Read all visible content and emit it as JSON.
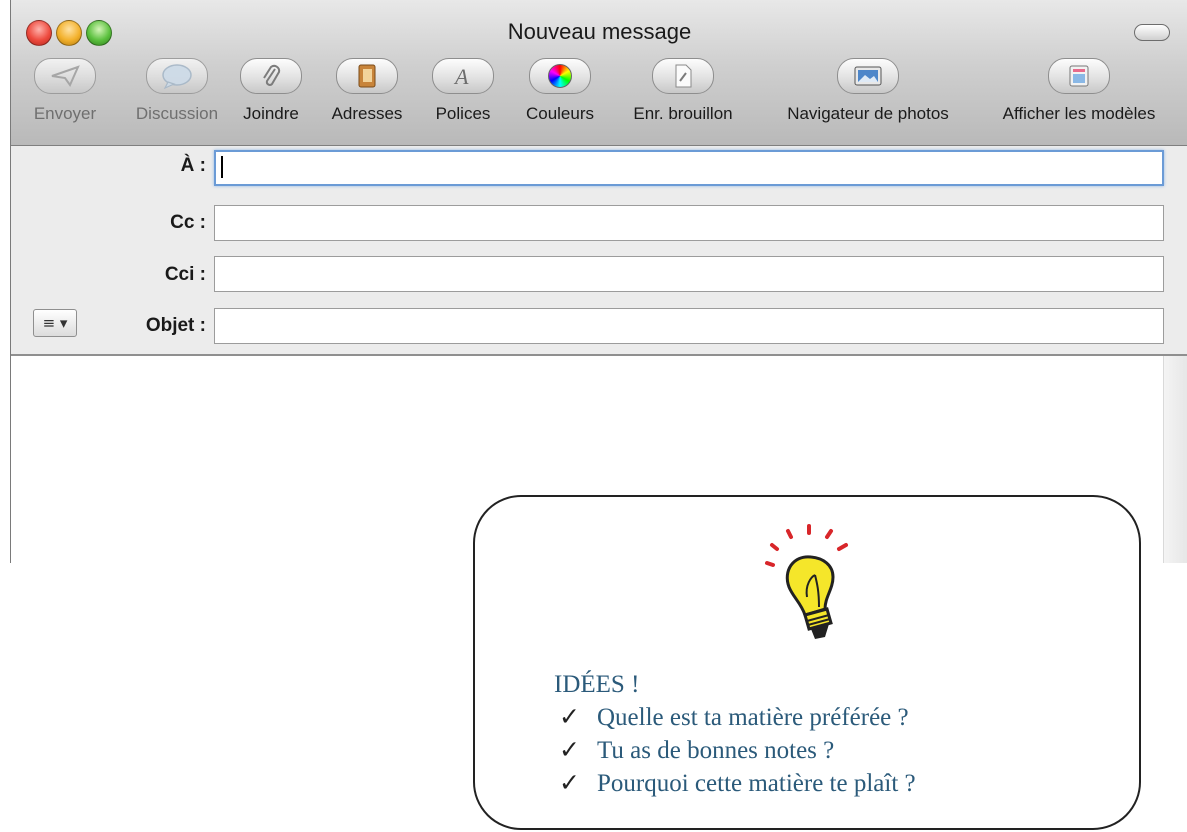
{
  "window": {
    "title": "Nouveau message"
  },
  "toolbar": {
    "items": [
      {
        "label": "Envoyer",
        "icon": "send-icon",
        "enabled": false
      },
      {
        "label": "Discussion",
        "icon": "chat-bubble-icon",
        "enabled": false
      },
      {
        "label": "Joindre",
        "icon": "paperclip-icon",
        "enabled": true
      },
      {
        "label": "Adresses",
        "icon": "address-book-icon",
        "enabled": true
      },
      {
        "label": "Polices",
        "icon": "font-icon",
        "enabled": true
      },
      {
        "label": "Couleurs",
        "icon": "color-wheel-icon",
        "enabled": true
      },
      {
        "label": "Enr. brouillon",
        "icon": "save-draft-icon",
        "enabled": true
      },
      {
        "label": "Navigateur de photos",
        "icon": "photo-browser-icon",
        "enabled": true
      },
      {
        "label": "Afficher les modèles",
        "icon": "stationery-icon",
        "enabled": true
      }
    ]
  },
  "fields": {
    "to": {
      "label": "À :",
      "value": ""
    },
    "cc": {
      "label": "Cc :",
      "value": ""
    },
    "bcc": {
      "label": "Cci :",
      "value": ""
    },
    "subject": {
      "label": "Objet :",
      "value": ""
    },
    "format_button": "≡ ▾"
  },
  "ideas": {
    "title": "IDÉES !",
    "items": [
      "Quelle est ta matière préférée ?",
      "Tu as de bonnes notes ?",
      "Pourquoi cette matière te plaît ?"
    ],
    "check_mark": "✓"
  },
  "colors": {
    "accent": "#6b9bd6",
    "ideas_text": "#2b5a7a",
    "bulb": "#f5e62a"
  }
}
